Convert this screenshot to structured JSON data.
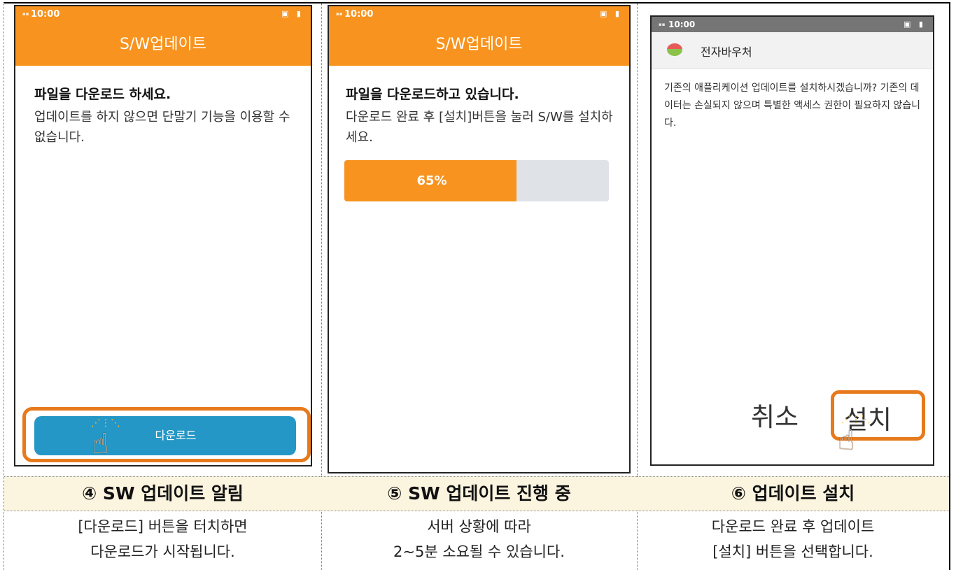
{
  "theme": {
    "accent": "#f7931e",
    "highlight": "#e77a1c",
    "button": "#2597c6",
    "caption_bg": "#fbf4df"
  },
  "panel1": {
    "status_time": "10:00",
    "app_title": "S/W업데이트",
    "heading": "파일을 다운로드 하세요.",
    "body": "업데이트를 하지 않으면 단말기 기능을 이용할 수 없습니다.",
    "button_label": "다운로드",
    "icon": "tap-hand-icon",
    "caption": "④ SW 업데이트 알림",
    "desc_line1": "[다운로드] 버튼을 터치하면",
    "desc_line2": "다운로드가 시작됩니다."
  },
  "panel2": {
    "status_time": "10:00",
    "app_title": "S/W업데이트",
    "heading": "파일을 다운로드하고 있습니다.",
    "body": "다운로드 완료 후 [설치]버튼을 눌러 S/W를 설치하세요.",
    "progress_label": "65%",
    "progress_value": 0.65,
    "caption": "⑤ SW 업데이트 진행 중",
    "desc_line1": "서버 상황에 따라",
    "desc_line2": "2~5분 소요될 수 있습니다."
  },
  "panel3": {
    "status_time": "10:00",
    "app_name": "전자바우처",
    "body": "기존의 애플리케이션 업데이트를 설치하시겠습니까? 기존의 데이터는 손실되지 않으며 특별한 액세스 권한이 필요하지 않습니다.",
    "cancel_label": "취소",
    "install_label": "설치",
    "icon": "tap-hand-icon",
    "caption": "⑥ 업데이트 설치",
    "desc_line1": "다운로드 완료 후 업데이트",
    "desc_line2": "[설치] 버튼을 선택합니다."
  }
}
